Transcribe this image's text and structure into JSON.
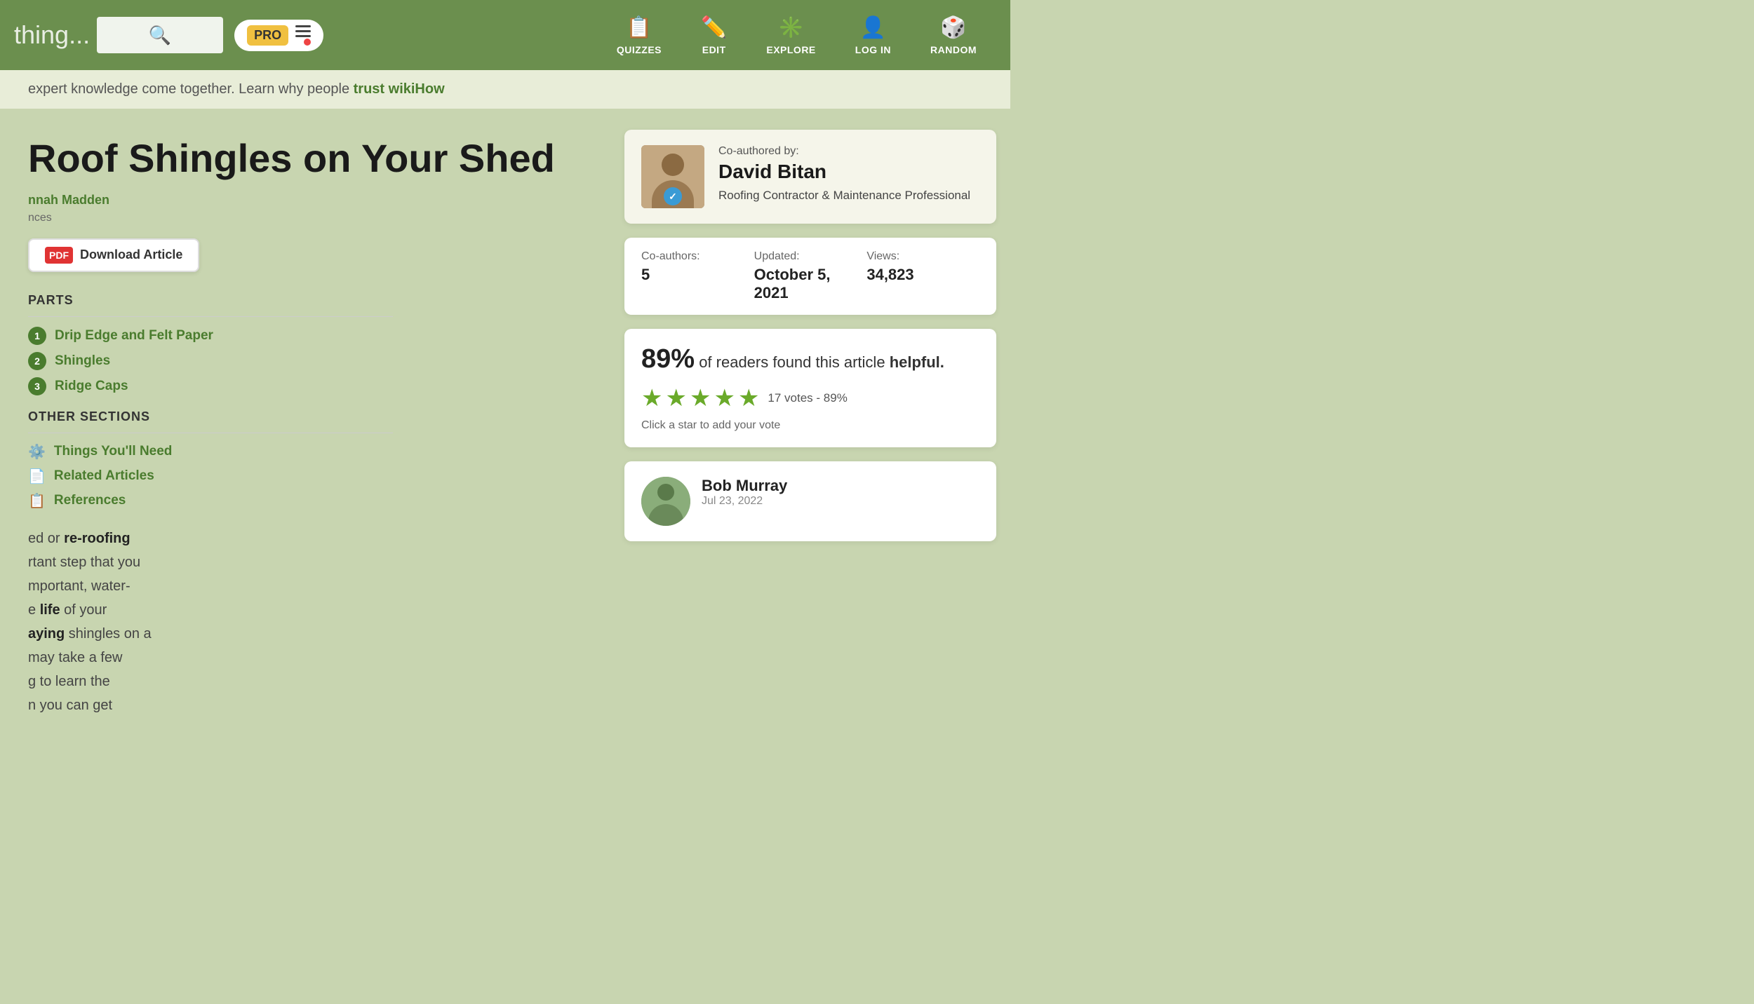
{
  "navbar": {
    "search_placeholder": "thing...",
    "pro_label": "PRO",
    "nav_items": [
      {
        "id": "quizzes",
        "label": "QUIZZES",
        "icon": "📋"
      },
      {
        "id": "edit",
        "label": "EDIT",
        "icon": "✏️"
      },
      {
        "id": "explore",
        "label": "EXPLORE",
        "icon": "✳️"
      },
      {
        "id": "login",
        "label": "LOG IN",
        "icon": "👤"
      },
      {
        "id": "random",
        "label": "RANDOM",
        "icon": "🎲"
      }
    ]
  },
  "trust_bar": {
    "text_before": "expert knowledge come together. Learn why people ",
    "link_text": "trust wikiHow"
  },
  "article": {
    "title": "Roof Shingles on Your Shed",
    "author_label": "nnah Madden",
    "references_label": "nces",
    "pdf_button": "Download Article",
    "parts_heading": "PARTS",
    "parts": [
      {
        "num": "1",
        "label": "Drip Edge and Felt Paper"
      },
      {
        "num": "2",
        "label": "Shingles"
      },
      {
        "num": "3",
        "label": "Ridge Caps"
      }
    ],
    "other_sections_heading": "OTHER SECTIONS",
    "other_sections": [
      {
        "icon": "⚙️",
        "label": "Things You'll Need"
      },
      {
        "icon": "📄",
        "label": "Related Articles"
      },
      {
        "icon": "📋",
        "label": "References"
      }
    ],
    "body_lines": [
      "ed or re-roofing",
      "rtant step that you",
      "mportant, water-",
      "e life of your",
      "aying shingles on a",
      "may take a few",
      "g to learn the",
      "n you can get"
    ]
  },
  "coauthor": {
    "label": "Co-authored by:",
    "name": "David Bitan",
    "verified": true,
    "title": "Roofing Contractor & Maintenance Professional"
  },
  "stats": {
    "coauthors_label": "Co-authors:",
    "coauthors_value": "5",
    "updated_label": "Updated:",
    "updated_value": "October 5, 2021",
    "views_label": "Views:",
    "views_value": "34,823"
  },
  "rating": {
    "percent": "89%",
    "headline_mid": "of readers found this article",
    "headline_end": "helpful.",
    "stars_filled": 4,
    "stars_half": 1,
    "stars_empty": 0,
    "votes_text": "17 votes - 89%",
    "cta": "Click a star to add your vote"
  },
  "comment": {
    "name": "Bob Murray",
    "date": "Jul 23, 2022"
  }
}
